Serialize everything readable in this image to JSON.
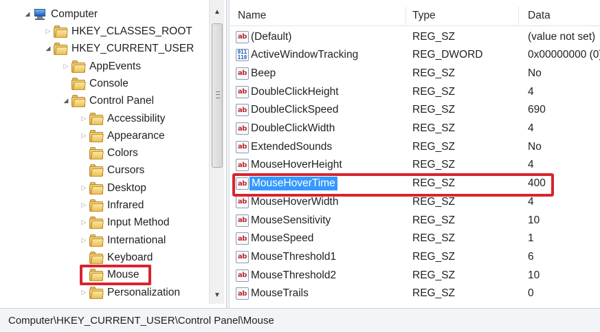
{
  "tree": {
    "items": [
      {
        "label": "Computer",
        "icon": "computer-icon",
        "toggle": "expanded"
      },
      {
        "label": "HKEY_CLASSES_ROOT",
        "icon": "folder-icon",
        "toggle": "collapsed"
      },
      {
        "label": "HKEY_CURRENT_USER",
        "icon": "folder-icon",
        "toggle": "expanded"
      },
      {
        "label": "AppEvents",
        "icon": "folder-icon",
        "toggle": "collapsed"
      },
      {
        "label": "Console",
        "icon": "folder-icon",
        "toggle": "none"
      },
      {
        "label": "Control Panel",
        "icon": "folder-icon",
        "toggle": "expanded"
      },
      {
        "label": "Accessibility",
        "icon": "folder-icon",
        "toggle": "collapsed"
      },
      {
        "label": "Appearance",
        "icon": "folder-icon",
        "toggle": "collapsed"
      },
      {
        "label": "Colors",
        "icon": "folder-icon",
        "toggle": "none"
      },
      {
        "label": "Cursors",
        "icon": "folder-icon",
        "toggle": "none"
      },
      {
        "label": "Desktop",
        "icon": "folder-icon",
        "toggle": "collapsed"
      },
      {
        "label": "Infrared",
        "icon": "folder-icon",
        "toggle": "collapsed"
      },
      {
        "label": "Input Method",
        "icon": "folder-icon",
        "toggle": "collapsed"
      },
      {
        "label": "International",
        "icon": "folder-icon",
        "toggle": "collapsed"
      },
      {
        "label": "Keyboard",
        "icon": "folder-icon",
        "toggle": "none"
      },
      {
        "label": "Mouse",
        "icon": "folder-icon",
        "toggle": "none",
        "selected": true
      },
      {
        "label": "Personalization",
        "icon": "folder-icon",
        "toggle": "collapsed"
      }
    ]
  },
  "list": {
    "columns": {
      "name": "Name",
      "type": "Type",
      "data": "Data"
    },
    "rows": [
      {
        "name": "(Default)",
        "type": "REG_SZ",
        "data": "(value not set)",
        "icon": "string-value-icon"
      },
      {
        "name": "ActiveWindowTracking",
        "type": "REG_DWORD",
        "data": "0x00000000 (0)",
        "icon": "dword-value-icon"
      },
      {
        "name": "Beep",
        "type": "REG_SZ",
        "data": "No",
        "icon": "string-value-icon"
      },
      {
        "name": "DoubleClickHeight",
        "type": "REG_SZ",
        "data": "4",
        "icon": "string-value-icon"
      },
      {
        "name": "DoubleClickSpeed",
        "type": "REG_SZ",
        "data": "690",
        "icon": "string-value-icon"
      },
      {
        "name": "DoubleClickWidth",
        "type": "REG_SZ",
        "data": "4",
        "icon": "string-value-icon"
      },
      {
        "name": "ExtendedSounds",
        "type": "REG_SZ",
        "data": "No",
        "icon": "string-value-icon"
      },
      {
        "name": "MouseHoverHeight",
        "type": "REG_SZ",
        "data": "4",
        "icon": "string-value-icon"
      },
      {
        "name": "MouseHoverTime",
        "type": "REG_SZ",
        "data": "400",
        "icon": "string-value-icon",
        "selected": true
      },
      {
        "name": "MouseHoverWidth",
        "type": "REG_SZ",
        "data": "4",
        "icon": "string-value-icon"
      },
      {
        "name": "MouseSensitivity",
        "type": "REG_SZ",
        "data": "10",
        "icon": "string-value-icon"
      },
      {
        "name": "MouseSpeed",
        "type": "REG_SZ",
        "data": "1",
        "icon": "string-value-icon"
      },
      {
        "name": "MouseThreshold1",
        "type": "REG_SZ",
        "data": "6",
        "icon": "string-value-icon"
      },
      {
        "name": "MouseThreshold2",
        "type": "REG_SZ",
        "data": "10",
        "icon": "string-value-icon"
      },
      {
        "name": "MouseTrails",
        "type": "REG_SZ",
        "data": "0",
        "icon": "string-value-icon"
      }
    ]
  },
  "status": {
    "path": "Computer\\HKEY_CURRENT_USER\\Control Panel\\Mouse"
  },
  "icons": {
    "string_value_glyph": "ab",
    "dword_value_glyph": "011\n110"
  },
  "colors": {
    "selection": "#3399ff",
    "highlight_box": "#d8242e",
    "folder": "#ecbf55"
  }
}
